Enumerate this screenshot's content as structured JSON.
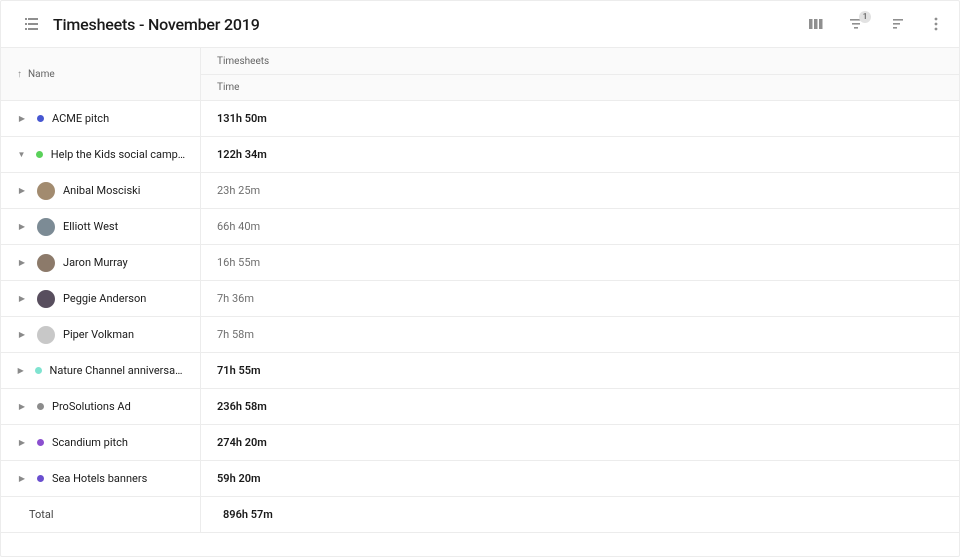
{
  "header": {
    "title": "Timesheets - November 2019",
    "filter_badge": "1"
  },
  "columns": {
    "name": "Name",
    "timesheets": "Timesheets",
    "time": "Time"
  },
  "projects": [
    {
      "name": "ACME pitch",
      "time": "131h 50m",
      "color": "#4757d1",
      "expanded": false
    },
    {
      "name": "Help the Kids social campaign",
      "time": "122h 34m",
      "color": "#5ad15a",
      "expanded": true,
      "users": [
        {
          "name": "Anibal Mosciski",
          "time": "23h 25m",
          "avatar_bg": "#a28b6f"
        },
        {
          "name": "Elliott West",
          "time": "66h 40m",
          "avatar_bg": "#7c8b95"
        },
        {
          "name": "Jaron Murray",
          "time": "16h 55m",
          "avatar_bg": "#8c7a6a"
        },
        {
          "name": "Peggie Anderson",
          "time": "7h 36m",
          "avatar_bg": "#584e5e"
        },
        {
          "name": "Piper Volkman",
          "time": "7h 58m",
          "avatar_bg": "#c8c8c8"
        }
      ]
    },
    {
      "name": "Nature Channel anniversary cam…",
      "time": "71h 55m",
      "color": "#7fe3d0",
      "expanded": false
    },
    {
      "name": "ProSolutions Ad",
      "time": "236h 58m",
      "color": "#8c8c8c",
      "expanded": false
    },
    {
      "name": "Scandium pitch",
      "time": "274h 20m",
      "color": "#8b4fcf",
      "expanded": false
    },
    {
      "name": "Sea Hotels banners",
      "time": "59h 20m",
      "color": "#6a4fcf",
      "expanded": false
    }
  ],
  "total": {
    "label": "Total",
    "time": "896h 57m"
  }
}
